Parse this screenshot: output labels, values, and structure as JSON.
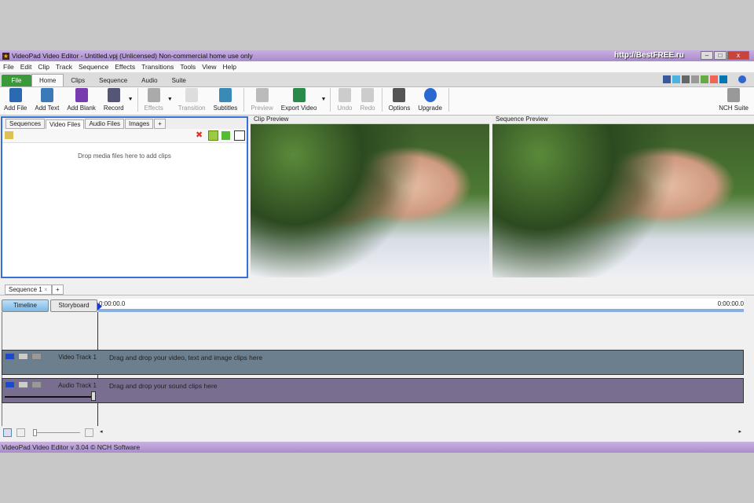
{
  "window": {
    "title": "VideoPad Video Editor - Untitled.vpj (Unlicensed) Non-commercial home use only",
    "watermark": "http://BestFREE.ru",
    "minimize": "–",
    "maximize": "□",
    "close": "x"
  },
  "menu": [
    "File",
    "Edit",
    "Clip",
    "Track",
    "Sequence",
    "Effects",
    "Transitions",
    "Tools",
    "View",
    "Help"
  ],
  "ribbon_tabs": [
    "File",
    "Home",
    "Clips",
    "Sequence",
    "Audio",
    "Suite"
  ],
  "toolbar": {
    "add_file": "Add File",
    "add_text": "Add Text",
    "add_blank": "Add Blank",
    "record": "Record",
    "effects": "Effects",
    "transition": "Transition",
    "subtitles": "Subtitles",
    "preview": "Preview",
    "export_video": "Export Video",
    "undo": "Undo",
    "redo": "Redo",
    "options": "Options",
    "upgrade": "Upgrade",
    "nch_suite": "NCH Suite"
  },
  "colors": {
    "accent": "#3a6fd8",
    "title": "#a98ccc",
    "video_track": "#6b7f8e",
    "audio_track": "#7a6e90"
  },
  "media": {
    "tabs": [
      "Sequences",
      "Video Files",
      "Audio Files",
      "Images",
      "+"
    ],
    "drop_text": "Drop media files here to add clips"
  },
  "clip_preview": {
    "label": "Clip Preview"
  },
  "sequence_preview": {
    "label": "Sequence Preview"
  },
  "sequence": {
    "tab": "Sequence 1",
    "close": "×",
    "add": "+"
  },
  "timeline": {
    "timeline_btn": "Timeline",
    "storyboard_btn": "Storyboard",
    "start_time": "0:00:00.0",
    "end_time": "0:00:00.0",
    "video_track": {
      "name": "Video Track 1",
      "msg": "Drag and drop your video, text and image clips here"
    },
    "audio_track": {
      "name": "Audio Track 1",
      "msg": "Drag and drop your sound clips here",
      "volume": 1.0
    }
  },
  "status": "VideoPad Video Editor v 3.04 © NCH Software"
}
